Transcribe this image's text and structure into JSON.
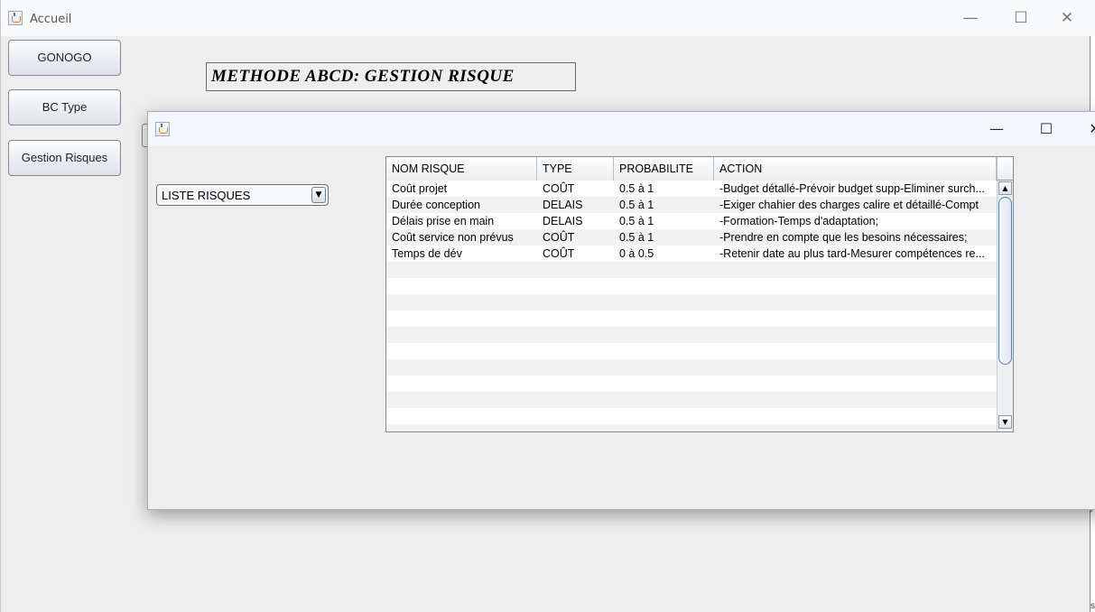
{
  "main_window": {
    "title": "Accueil",
    "controls": {
      "minimize": "—",
      "maximize": "☐",
      "close": "✕"
    },
    "nav_buttons": [
      "GONOGO",
      "BC Type",
      "Gestion Risques"
    ],
    "header": "METHODE ABCD: GESTION RISQUE"
  },
  "dialog": {
    "controls": {
      "minimize": "—",
      "maximize": "☐",
      "close": "✕"
    },
    "combo": {
      "selected": "LISTE RISQUES",
      "arrow": "▼"
    },
    "table": {
      "columns": [
        "NOM RISQUE",
        "TYPE",
        "PROBABILITE",
        "ACTION"
      ],
      "rows": [
        [
          "Coût projet",
          "COÛT",
          "0.5 à 1",
          "-Budget détallé-Prévoir budget supp-Eliminer surch..."
        ],
        [
          "Durée conception",
          "DELAIS",
          "0.5 à 1",
          "-Exiger chahier des charges calire et détaillé-Compt"
        ],
        [
          "Délais prise en main",
          "DELAIS",
          "0.5 à 1",
          "-Formation-Temps d'adaptation;"
        ],
        [
          "Coût service non prévus",
          "COÛT",
          "0.5 à 1",
          "-Prendre en compte que les besoins nécessaires;"
        ],
        [
          "Temps de dév",
          "COÛT",
          "0 à 0.5",
          "-Retenir date au plus tard-Mesurer compétences re..."
        ]
      ],
      "scroll_up": "▲",
      "scroll_down": "▼"
    }
  }
}
